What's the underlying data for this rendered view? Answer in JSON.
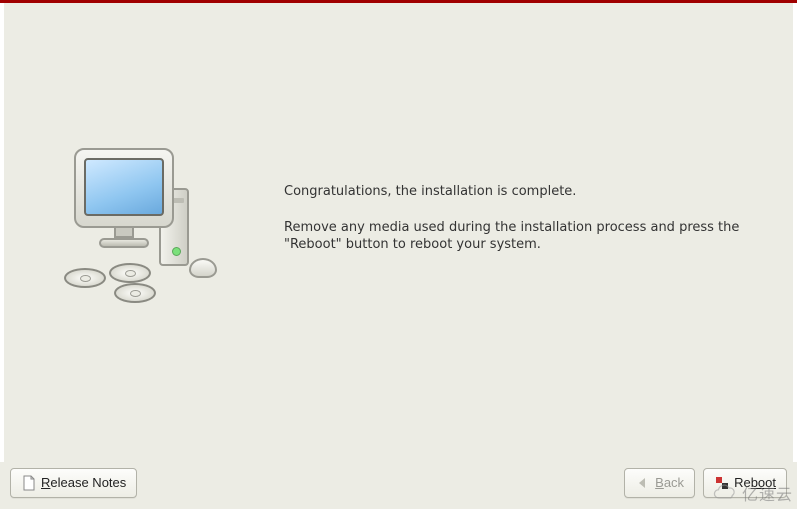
{
  "main": {
    "congrats": "Congratulations, the installation is complete.",
    "instruction": "Remove any media used during the installation process and press the \"Reboot\" button to reboot your system."
  },
  "footer": {
    "release_notes": {
      "label_prefix": "R",
      "label_rest": "elease Notes"
    },
    "back": {
      "label_prefix": "B",
      "label_rest": "ack"
    },
    "reboot": {
      "label_prefix": "Re",
      "label_rest": "boot"
    }
  },
  "watermark": {
    "text": "亿速云"
  },
  "icons": {
    "document": "document-icon",
    "arrow_left": "arrow-left-icon",
    "reboot": "reboot-icon"
  }
}
